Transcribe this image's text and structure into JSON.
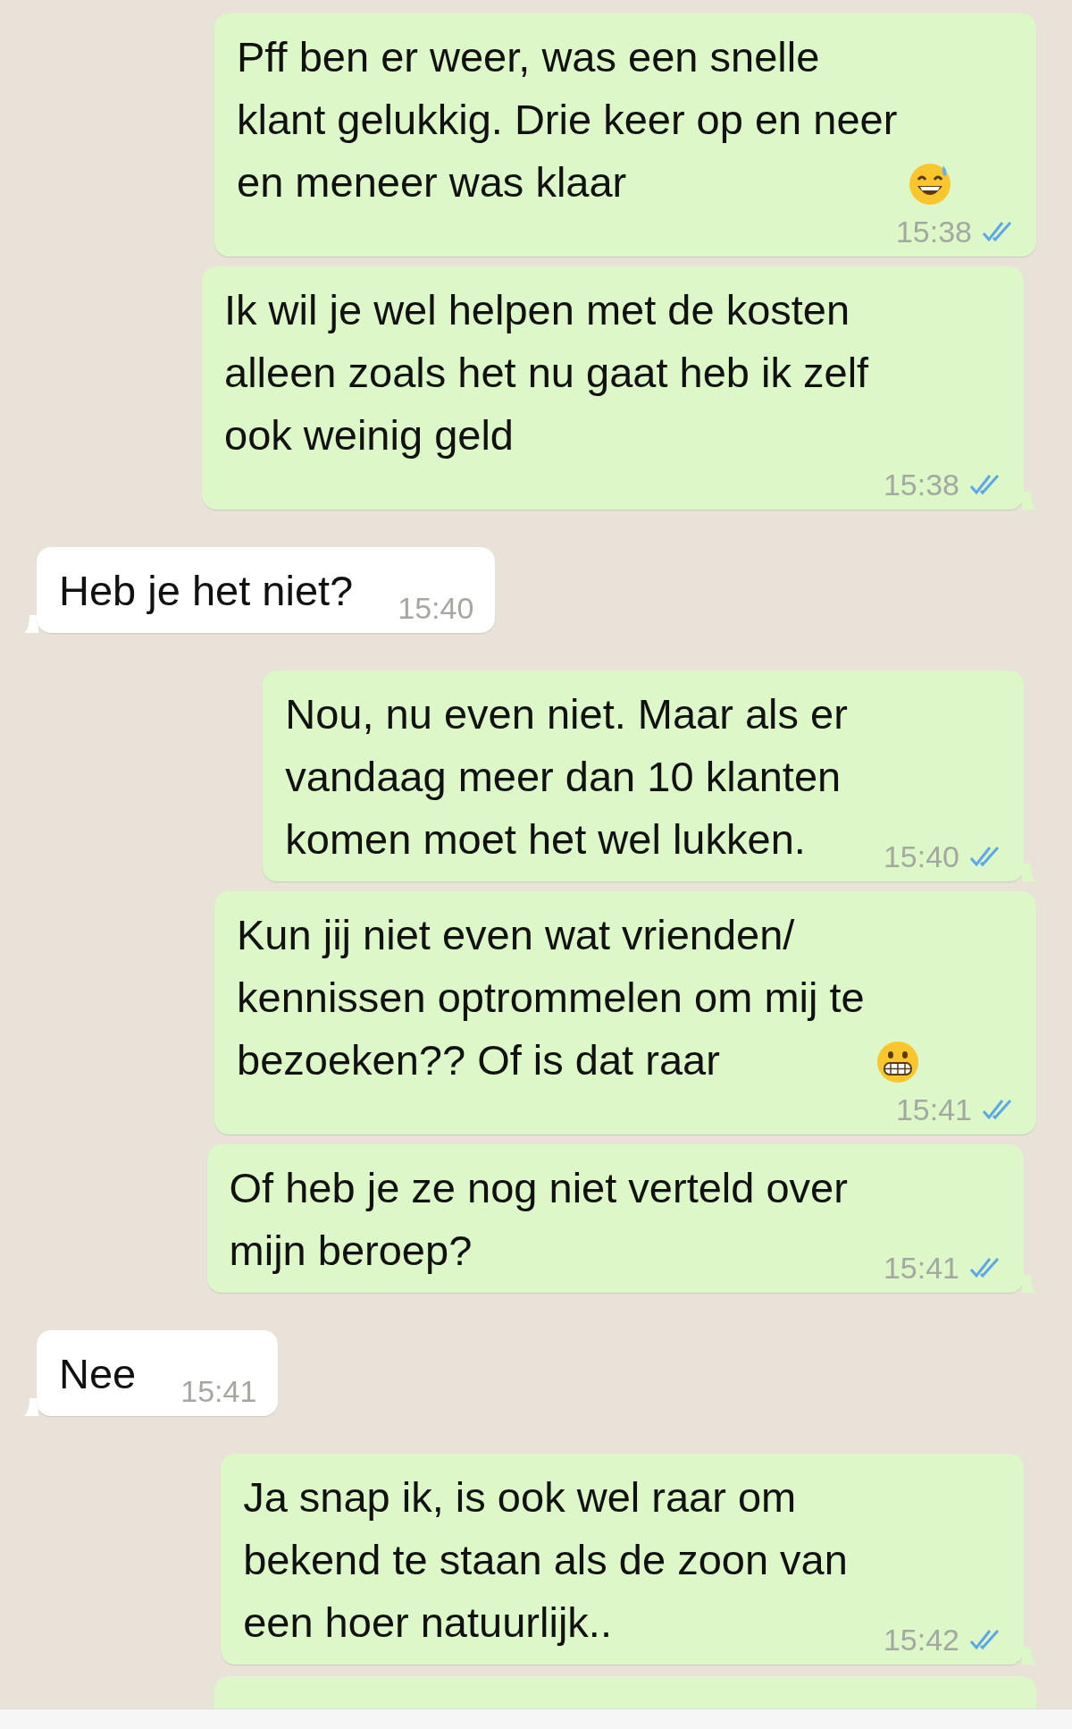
{
  "messages": [
    {
      "kind": "sent",
      "text": "Pff ben er weer, was een snelle\nklant gelukkig. Drie keer op en neer\nen meneer was klaar",
      "emoji": {
        "kind": "grin-sweat"
      },
      "time": "15:38",
      "read": true,
      "tail": false
    },
    {
      "kind": "sent",
      "text": "Ik wil je wel helpen met de kosten\nalleen zoals het nu gaat heb ik zelf\nook weinig geld",
      "time": "15:38",
      "read": true,
      "tail": true
    },
    {
      "kind": "received",
      "text": "Heb je het niet?",
      "time": "15:40",
      "tail": true
    },
    {
      "kind": "sent",
      "text": "Nou, nu even niet. Maar als er\nvandaag meer dan 10 klanten\nkomen moet het wel lukken.",
      "time": "15:40",
      "read": true,
      "tail": true
    },
    {
      "kind": "sent",
      "text": "Kun jij niet even wat vrienden/\nkennissen optrommelen om mij te\nbezoeken?? Of is dat raar",
      "emoji": {
        "kind": "grimace"
      },
      "time": "15:41",
      "read": true,
      "tail": false
    },
    {
      "kind": "sent",
      "text": "Of heb je ze nog niet verteld over\nmijn beroep?",
      "time": "15:41",
      "read": true,
      "tail": true
    },
    {
      "kind": "received",
      "text": "Nee",
      "time": "15:41",
      "tail": true
    },
    {
      "kind": "sent",
      "text": "Ja snap ik, is ook wel raar om\nbekend te staan als de zoon van\neen hoer natuurlijk..",
      "time": "15:42",
      "read": true,
      "tail": true
    },
    {
      "kind": "sent",
      "cut_off": true
    }
  ]
}
